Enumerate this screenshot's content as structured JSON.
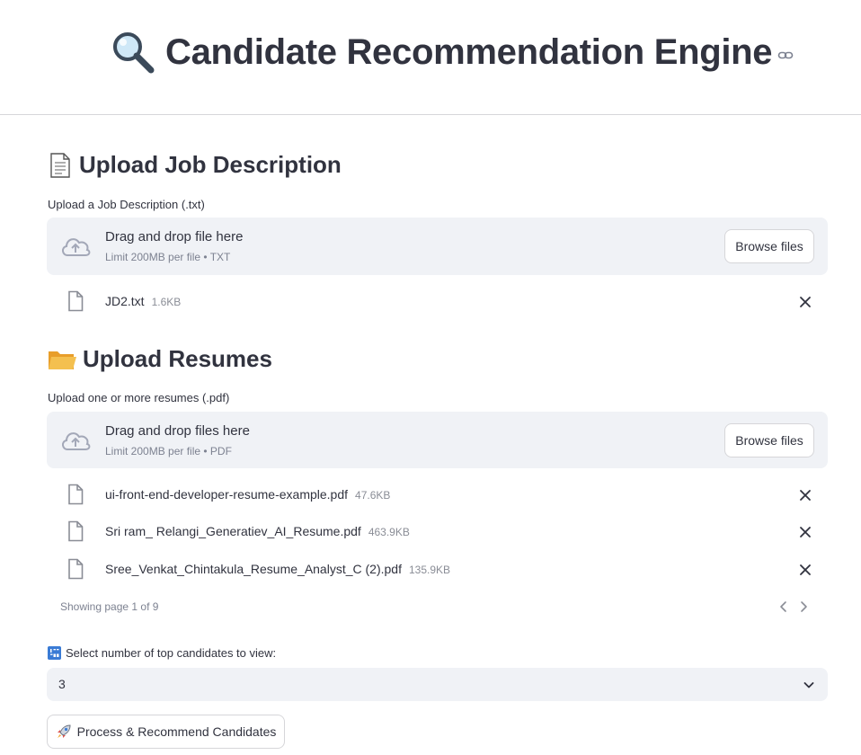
{
  "header": {
    "title": "Candidate Recommendation Engine",
    "title_icon": "magnifying-glass-icon",
    "anchor_icon": "link-icon"
  },
  "jd_section": {
    "heading": "Upload Job Description",
    "heading_icon": "page-icon",
    "uploader_label": "Upload a Job Description (.txt)",
    "dropzone_title": "Drag and drop file here",
    "dropzone_subtitle": "Limit 200MB per file • TXT",
    "browse_label": "Browse files",
    "files": [
      {
        "name": "JD2.txt",
        "size": "1.6KB"
      }
    ]
  },
  "resume_section": {
    "heading": "Upload Resumes",
    "heading_icon": "folder-icon",
    "uploader_label": "Upload one or more resumes (.pdf)",
    "dropzone_title": "Drag and drop files here",
    "dropzone_subtitle": "Limit 200MB per file • PDF",
    "browse_label": "Browse files",
    "files": [
      {
        "name": "ui-front-end-developer-resume-example.pdf",
        "size": "47.6KB"
      },
      {
        "name": "Sri ram_ Relangi_Generatiev_AI_Resume.pdf",
        "size": "463.9KB"
      },
      {
        "name": "Sree_Venkat_Chintakula_Resume_Analyst_C (2).pdf",
        "size": "135.9KB"
      }
    ],
    "pagination": "Showing page 1 of 9"
  },
  "top_n": {
    "label": "Select number of top candidates to view:",
    "label_icon": "numbers-icon",
    "selected": "3"
  },
  "process_button": {
    "label": "Process & Recommend Candidates",
    "icon": "rocket-icon"
  },
  "colors": {
    "text": "#31333f",
    "muted": "#7d8291",
    "panel": "#f0f2f6",
    "border": "#d6d6d9",
    "folder": "#f4b63f"
  }
}
